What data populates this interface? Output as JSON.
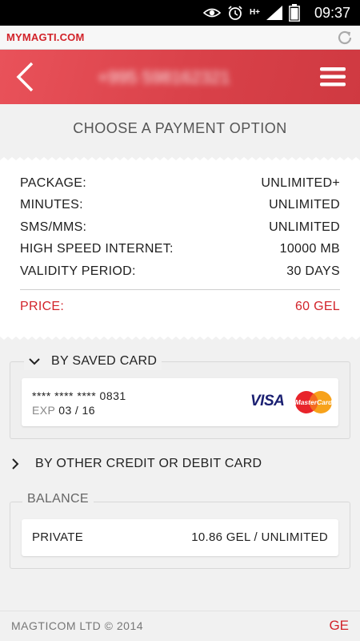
{
  "status_bar": {
    "time": "09:37",
    "network": "H+",
    "icons": [
      "eye-icon",
      "alarm-icon",
      "signal-icon",
      "battery-icon"
    ]
  },
  "browser": {
    "brand": "MYMAGTI.COM",
    "reload_icon": "reload-icon"
  },
  "header": {
    "phone_number": "+995 598162321",
    "back_icon": "chevron-left-icon",
    "menu_icon": "hamburger-icon",
    "accent_color": "#d94149"
  },
  "page": {
    "title": "CHOOSE A PAYMENT OPTION"
  },
  "package": {
    "rows": [
      {
        "label": "PACKAGE:",
        "value": "UNLIMITED+"
      },
      {
        "label": "MINUTES:",
        "value": "UNLIMITED"
      },
      {
        "label": "SMS/MMS:",
        "value": "UNLIMITED"
      },
      {
        "label": "HIGH SPEED INTERNET:",
        "value": "10000 MB"
      },
      {
        "label": "VALIDITY PERIOD:",
        "value": "30 DAYS"
      }
    ],
    "price_label": "PRICE:",
    "price_value": "60 GEL",
    "price_color": "#d2232a"
  },
  "saved_card": {
    "header": "BY SAVED CARD",
    "number": "**** **** **** 0831",
    "exp_label": "EXP",
    "exp_value": "03 / 16",
    "brand_visa": "VISA",
    "brand_mc": "MasterCard"
  },
  "other_card": {
    "label": "BY OTHER CREDIT OR DEBIT CARD"
  },
  "balance": {
    "header": "BALANCE",
    "name": "PRIVATE",
    "value": "10.86 GEL / UNLIMITED"
  },
  "footer": {
    "copyright": "MAGTICOM LTD © 2014",
    "language": "GE"
  }
}
